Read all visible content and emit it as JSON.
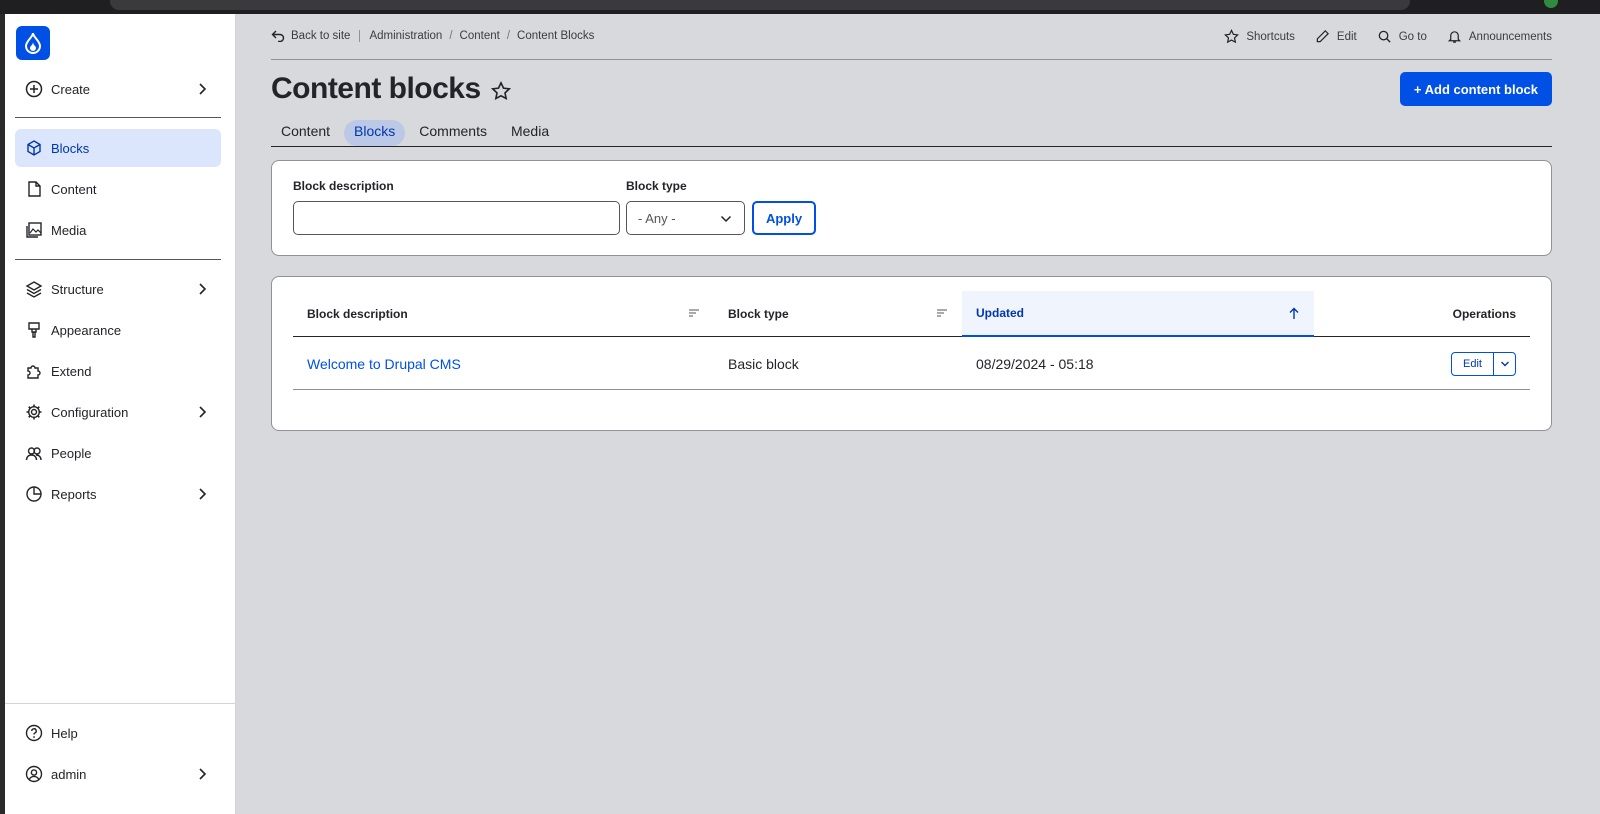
{
  "sidebar": {
    "logo_icon": "drupal-drop-icon",
    "items": [
      {
        "label": "Create",
        "icon": "plus-circle-icon",
        "has_chevron": true
      },
      {
        "label": "Blocks",
        "icon": "cube-icon",
        "active": true
      },
      {
        "label": "Content",
        "icon": "document-icon"
      },
      {
        "label": "Media",
        "icon": "image-icon"
      },
      {
        "label": "Structure",
        "icon": "layers-icon",
        "has_chevron": true
      },
      {
        "label": "Appearance",
        "icon": "brush-icon"
      },
      {
        "label": "Extend",
        "icon": "puzzle-icon"
      },
      {
        "label": "Configuration",
        "icon": "gear-icon",
        "has_chevron": true
      },
      {
        "label": "People",
        "icon": "people-icon"
      },
      {
        "label": "Reports",
        "icon": "pie-chart-icon",
        "has_chevron": true
      }
    ],
    "footer": [
      {
        "label": "Help",
        "icon": "help-icon"
      },
      {
        "label": "admin",
        "icon": "user-icon",
        "has_chevron": true
      }
    ]
  },
  "topbar": {
    "back": "Back to site",
    "breadcrumb": [
      "Administration",
      "Content",
      "Content Blocks"
    ],
    "tools": [
      "Shortcuts",
      "Edit",
      "Go to",
      "Announcements"
    ]
  },
  "page": {
    "title": "Content blocks",
    "add_button": "+ Add content block",
    "tabs": [
      "Content",
      "Blocks",
      "Comments",
      "Media"
    ],
    "active_tab": "Blocks"
  },
  "filter": {
    "description_label": "Block description",
    "description_value": "",
    "type_label": "Block type",
    "type_value": "- Any -",
    "apply": "Apply"
  },
  "table": {
    "headers": [
      "Block description",
      "Block type",
      "Updated",
      "Operations"
    ],
    "sorted_column": "Updated",
    "rows": [
      {
        "description": "Welcome to Drupal CMS",
        "type": "Basic block",
        "updated": "08/29/2024 - 05:18",
        "operation": "Edit"
      }
    ]
  },
  "colors": {
    "accent": "#0050e6",
    "active_bg": "#dbe5fb",
    "page_bg": "#d8d9dd"
  }
}
